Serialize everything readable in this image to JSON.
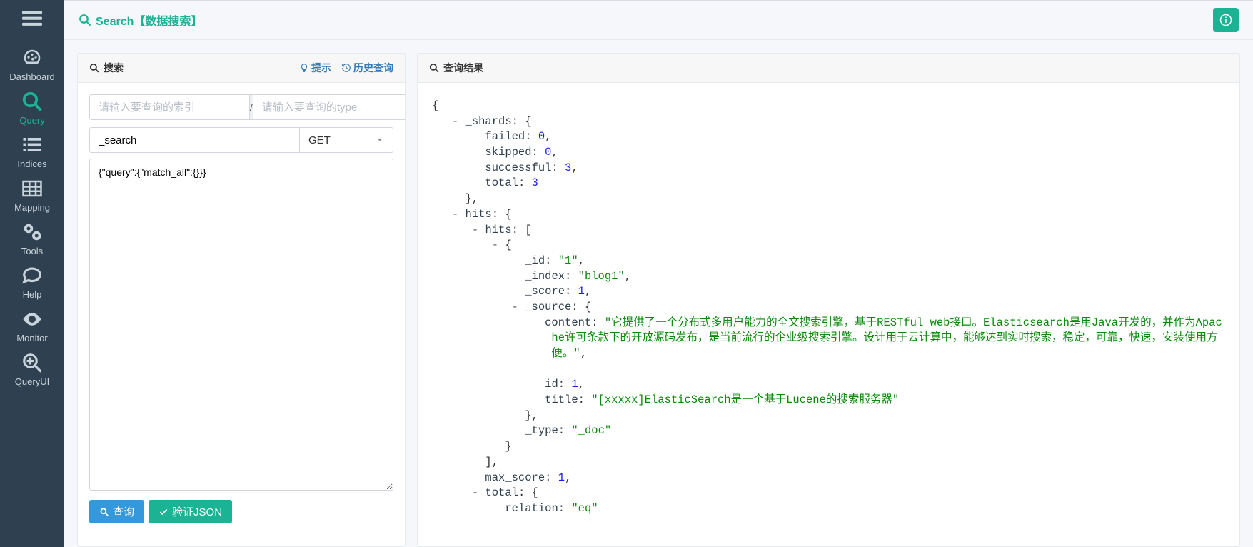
{
  "page": {
    "title": "Search【数据搜索】"
  },
  "sidebar": {
    "items": [
      {
        "label": "Dashboard"
      },
      {
        "label": "Query"
      },
      {
        "label": "Indices"
      },
      {
        "label": "Mapping"
      },
      {
        "label": "Tools"
      },
      {
        "label": "Help"
      },
      {
        "label": "Monitor"
      },
      {
        "label": "QueryUI"
      }
    ]
  },
  "search_panel": {
    "title": "搜索",
    "tips_label": "提示",
    "history_label": "历史查询",
    "index_placeholder": "请输入要查询的索引",
    "type_placeholder": "请输入要查询的type",
    "slash": "/",
    "endpoint_value": "_search",
    "method_value": "GET",
    "body_value": "{\"query\":{\"match_all\":{}}}",
    "query_btn": "查询",
    "validate_btn": "验证JSON"
  },
  "result_panel": {
    "title": "查询结果",
    "json": {
      "_shards": {
        "failed": 0,
        "skipped": 0,
        "successful": 3,
        "total": 3
      },
      "hits": {
        "hits": [
          {
            "_id": "\"1\"",
            "_index": "\"blog1\"",
            "_score": 1,
            "_source": {
              "content": "\"它提供了一个分布式多用户能力的全文搜索引擎，基于RESTful web接口。Elasticsearch是用Java开发的，并作为Apache许可条款下的开放源码发布，是当前流行的企业级搜索引擎。设计用于云计算中，能够达到实时搜索，稳定，可靠，快速，安装使用方便。\"",
              "id": 1,
              "title": "\"[xxxxx]ElasticSearch是一个基于Lucene的搜索服务器\""
            },
            "_type": "\"_doc\""
          }
        ],
        "max_score": 1,
        "total": {
          "relation": "\"eq\""
        }
      }
    }
  }
}
